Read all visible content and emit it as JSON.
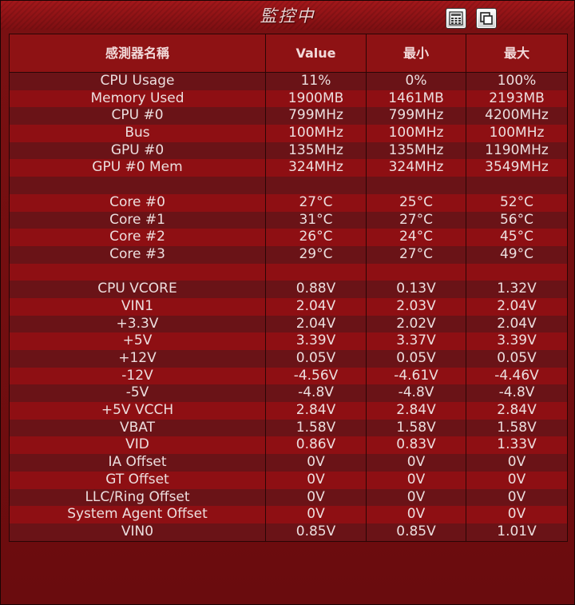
{
  "window": {
    "title": "監控中",
    "buttons": [
      "calculator-icon",
      "restore-window-icon"
    ]
  },
  "table": {
    "headers": [
      "感測器名稱",
      "Value",
      "最小",
      "最大"
    ],
    "rows": [
      [
        "CPU Usage",
        "11%",
        "0%",
        "100%"
      ],
      [
        "Memory Used",
        "1900MB",
        "1461MB",
        "2193MB"
      ],
      [
        "CPU #0",
        "799MHz",
        "799MHz",
        "4200MHz"
      ],
      [
        "Bus",
        "100MHz",
        "100MHz",
        "100MHz"
      ],
      [
        "GPU #0",
        "135MHz",
        "135MHz",
        "1190MHz"
      ],
      [
        "GPU #0 Mem",
        "324MHz",
        "324MHz",
        "3549MHz"
      ],
      [
        "",
        "",
        "",
        ""
      ],
      [
        "Core #0",
        "27°C",
        "25°C",
        "52°C"
      ],
      [
        "Core #1",
        "31°C",
        "27°C",
        "56°C"
      ],
      [
        "Core #2",
        "26°C",
        "24°C",
        "45°C"
      ],
      [
        "Core #3",
        "29°C",
        "27°C",
        "49°C"
      ],
      [
        "",
        "",
        "",
        ""
      ],
      [
        "CPU VCORE",
        "0.88V",
        "0.13V",
        "1.32V"
      ],
      [
        "VIN1",
        "2.04V",
        "2.03V",
        "2.04V"
      ],
      [
        "+3.3V",
        "2.04V",
        "2.02V",
        "2.04V"
      ],
      [
        "+5V",
        "3.39V",
        "3.37V",
        "3.39V"
      ],
      [
        "+12V",
        "0.05V",
        "0.05V",
        "0.05V"
      ],
      [
        "-12V",
        "-4.56V",
        "-4.61V",
        "-4.46V"
      ],
      [
        "-5V",
        "-4.8V",
        "-4.8V",
        "-4.8V"
      ],
      [
        "+5V VCCH",
        "2.84V",
        "2.84V",
        "2.84V"
      ],
      [
        "VBAT",
        "1.58V",
        "1.58V",
        "1.58V"
      ],
      [
        "VID",
        "0.86V",
        "0.83V",
        "1.33V"
      ],
      [
        "IA Offset",
        "0V",
        "0V",
        "0V"
      ],
      [
        "GT Offset",
        "0V",
        "0V",
        "0V"
      ],
      [
        "LLC/Ring Offset",
        "0V",
        "0V",
        "0V"
      ],
      [
        "System Agent Offset",
        "0V",
        "0V",
        "0V"
      ],
      [
        "VIN0",
        "0.85V",
        "0.85V",
        "1.01V"
      ]
    ]
  }
}
